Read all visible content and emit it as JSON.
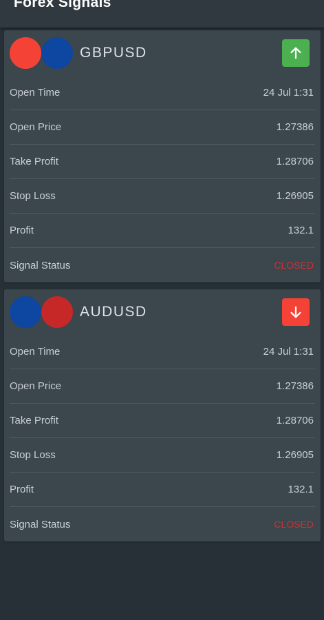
{
  "app": {
    "title": "Forex Signals"
  },
  "colors": {
    "background": "#273037",
    "card": "#3b464d",
    "buy": "#4caf50",
    "sell": "#f44336",
    "closed": "#d32f2f"
  },
  "signals": [
    {
      "pair": "GBPUSD",
      "direction": "up",
      "direction_icon": "arrow-up-icon",
      "flag_colors": [
        "#f44336",
        "#0d47a1"
      ],
      "rows": [
        {
          "label": "Open Time",
          "value": "24 Jul 1:31"
        },
        {
          "label": "Open Price",
          "value": "1.27386"
        },
        {
          "label": "Take Profit",
          "value": "1.28706"
        },
        {
          "label": "Stop Loss",
          "value": "1.26905"
        },
        {
          "label": "Profit",
          "value": "132.1"
        },
        {
          "label": "Signal Status",
          "value": "CLOSED"
        }
      ]
    },
    {
      "pair": "AUDUSD",
      "direction": "down",
      "direction_icon": "arrow-down-icon",
      "flag_colors": [
        "#0d47a1",
        "#c62828"
      ],
      "rows": [
        {
          "label": "Open Time",
          "value": "24 Jul 1:31"
        },
        {
          "label": "Open Price",
          "value": "1.27386"
        },
        {
          "label": "Take Profit",
          "value": "1.28706"
        },
        {
          "label": "Stop Loss",
          "value": "1.26905"
        },
        {
          "label": "Profit",
          "value": "132.1"
        },
        {
          "label": "Signal Status",
          "value": "CLOSED"
        }
      ]
    }
  ]
}
